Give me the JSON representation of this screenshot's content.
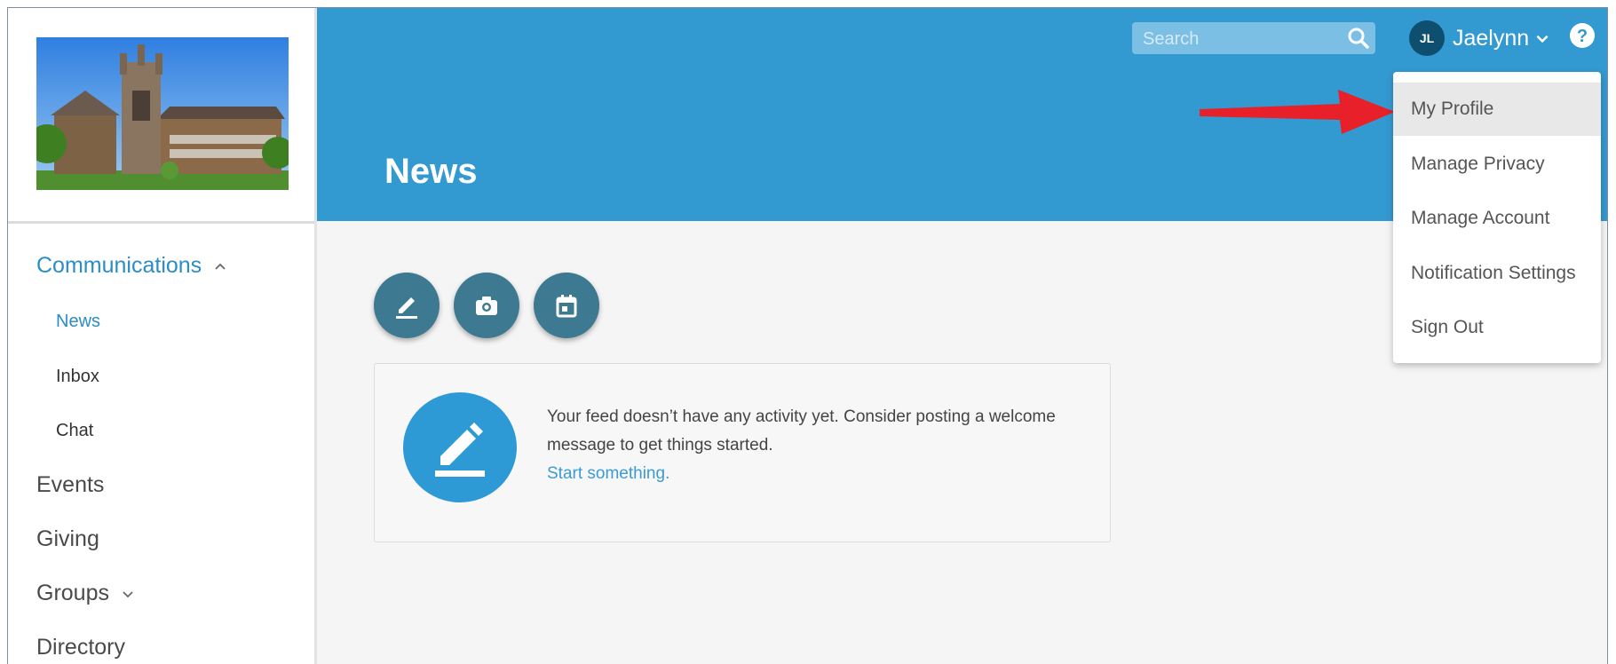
{
  "header": {
    "page_title": "News",
    "search_placeholder": "Search",
    "user": {
      "initials": "JL",
      "name": "Jaelynn"
    }
  },
  "sidebar": {
    "items": [
      {
        "label": "Communications",
        "expanded": true
      },
      {
        "label": "Events"
      },
      {
        "label": "Giving"
      },
      {
        "label": "Groups",
        "expanded": false
      },
      {
        "label": "Directory"
      }
    ],
    "sub_items": [
      {
        "label": "News",
        "active": true
      },
      {
        "label": "Inbox"
      },
      {
        "label": "Chat"
      }
    ]
  },
  "user_menu": {
    "items": [
      {
        "label": "My Profile",
        "highlighted": true
      },
      {
        "label": "Manage Privacy"
      },
      {
        "label": "Manage Account"
      },
      {
        "label": "Notification Settings"
      },
      {
        "label": "Sign Out"
      }
    ]
  },
  "actions": [
    {
      "icon": "pencil-icon"
    },
    {
      "icon": "camera-icon"
    },
    {
      "icon": "calendar-icon"
    }
  ],
  "feed": {
    "empty_message": "Your feed doesn’t have any activity yet. Consider posting a welcome message to get things started.",
    "start_link": "Start something."
  },
  "colors": {
    "header_bg": "#3399d1",
    "accent": "#2b8dc6",
    "fab_bg": "#3d7990",
    "arrow": "#e8202a"
  }
}
